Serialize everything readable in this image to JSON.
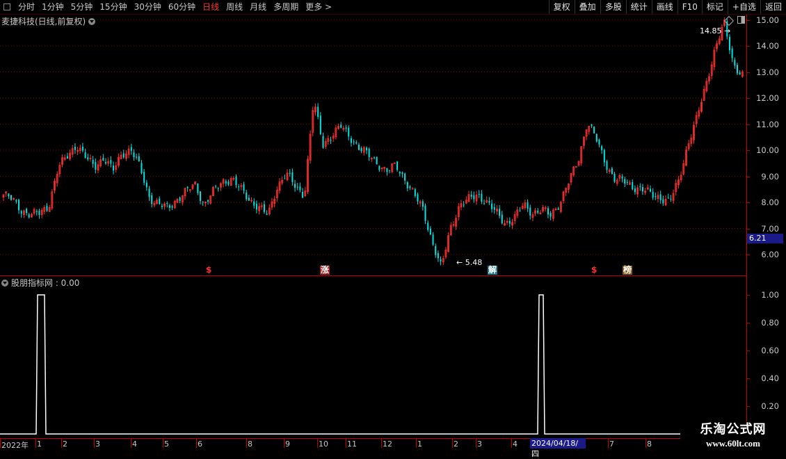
{
  "toolbar": {
    "periods": [
      "分时",
      "1分钟",
      "5分钟",
      "15分钟",
      "30分钟",
      "60分钟",
      "日线",
      "周线",
      "月线",
      "多周期",
      "更多 >"
    ],
    "active_period": "日线",
    "buttons": [
      "复权",
      "叠加",
      "多股",
      "统计",
      "画线",
      "F10",
      "标记",
      "+自选",
      "返回"
    ]
  },
  "main": {
    "title": "麦捷科技(日线,前复权)",
    "high_label": "14.85",
    "low_label": "5.48",
    "current_price": "6.21",
    "markers": [
      {
        "text": "$",
        "color": "#ff3030"
      },
      {
        "text": "涨",
        "color": "#ffffff",
        "bg": "#aa2020"
      },
      {
        "text": "解",
        "color": "#ffffff",
        "bg": "#1a7a8a"
      },
      {
        "text": "$",
        "color": "#ff3030"
      },
      {
        "text": "榜",
        "color": "#ffffff",
        "bg": "#8a5a10"
      }
    ]
  },
  "indicator": {
    "title": "股朋指标网 : 0.00"
  },
  "axis": {
    "price_labels": [
      "15.00",
      "14.00",
      "13.00",
      "12.00",
      "11.00",
      "10.00",
      "9.00",
      "8.00",
      "7.00",
      "6.00"
    ],
    "indicator_labels": [
      "1.00",
      "0.80",
      "0.60",
      "0.40",
      "0.20"
    ]
  },
  "xaxis": {
    "labels": [
      "2022年",
      "1",
      "2",
      "3",
      "4",
      "5",
      "6",
      "8",
      "9",
      "10",
      "11",
      "12",
      "1",
      "2",
      "3",
      "4",
      "7",
      "8"
    ],
    "cursor_date": "2024/04/18/四"
  },
  "watermark": {
    "line1": "乐淘公式网",
    "line2": "www.60lt.com"
  },
  "colors": {
    "up": "#ff3030",
    "down": "#00e4e4",
    "grid": "#8a0000",
    "indicator_line": "#ffffff"
  },
  "chart_data": {
    "type": "line",
    "title": "麦捷科技(日线,前复权)",
    "series": [
      {
        "values": [
          8.3,
          8.1,
          7.7,
          7.5,
          7.6,
          7.9,
          9.3,
          9.8,
          10.2,
          9.7,
          9.4,
          9.7,
          9.2,
          9.9,
          10.0,
          9.3,
          8.2,
          7.9,
          7.8,
          8.1,
          8.4,
          8.7,
          7.9,
          8.4,
          8.8,
          8.9,
          8.5,
          8.1,
          7.8,
          7.5,
          8.6,
          9.1,
          8.6,
          8.3,
          11.9,
          10.2,
          10.6,
          10.9,
          10.5,
          10.1,
          9.8,
          9.5,
          9.2,
          9.4,
          8.9,
          8.3,
          7.7,
          6.5,
          5.48,
          7.0,
          7.9,
          8.1,
          8.3,
          8.0,
          7.6,
          7.2,
          7.4,
          7.9,
          7.6,
          7.7,
          7.5,
          8.0,
          8.8,
          9.6,
          11.1,
          10.4,
          9.5,
          8.9,
          8.8,
          8.6,
          8.5,
          8.3,
          8.2,
          8.0,
          8.8,
          10.2,
          11.2,
          12.5,
          13.9,
          14.85,
          13.3,
          12.9
        ]
      }
    ],
    "ylim": [
      5.2,
      15.2
    ]
  },
  "indicator_data": {
    "type": "line",
    "ylim": [
      0,
      1.05
    ],
    "signal_ranges": [
      {
        "value": 1.0
      },
      {
        "value": 1.0
      }
    ]
  }
}
